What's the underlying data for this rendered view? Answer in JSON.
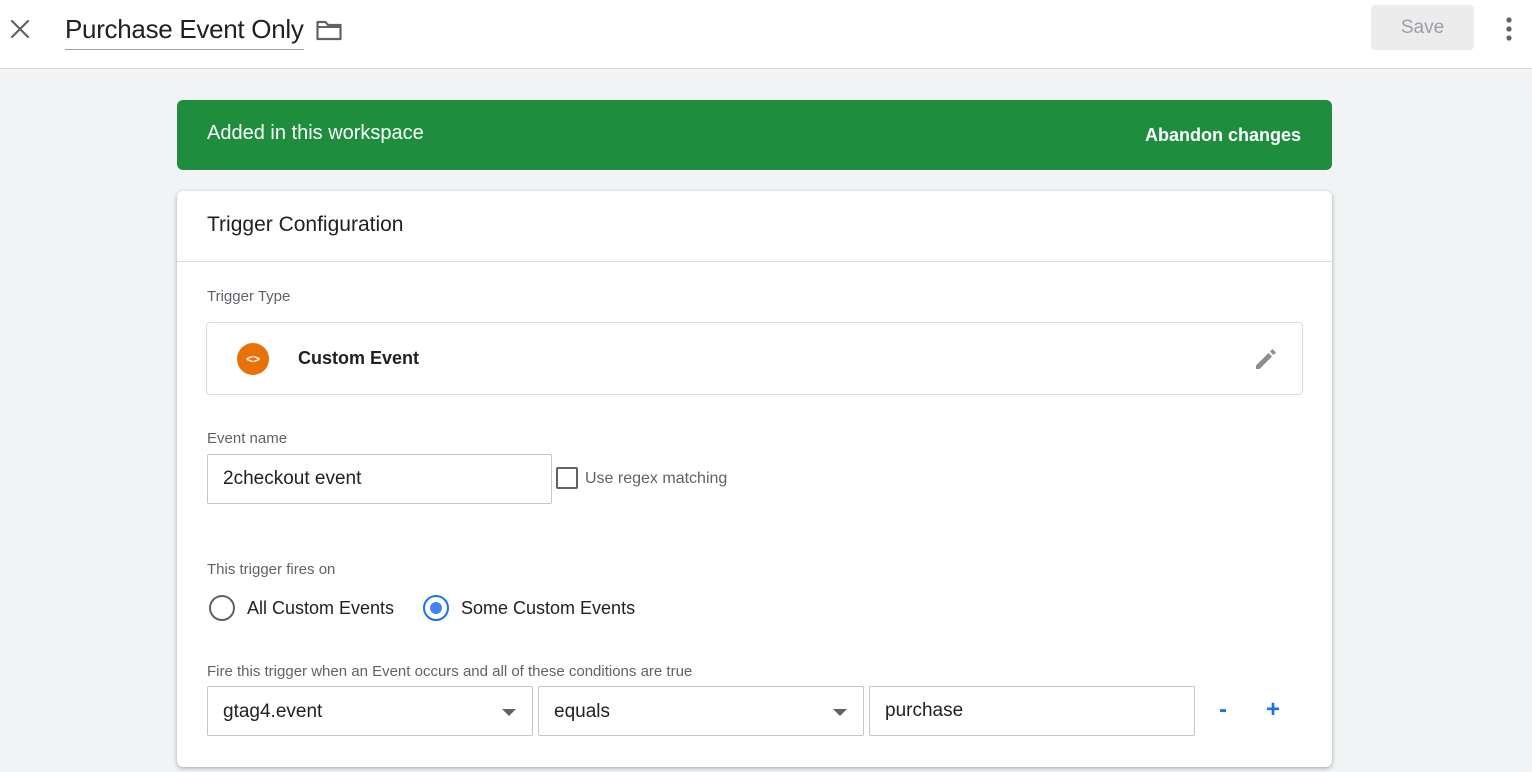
{
  "header": {
    "title": "Purchase Event Only",
    "save_label": "Save"
  },
  "banner": {
    "message": "Added in this workspace",
    "action_label": "Abandon changes",
    "color": "#1e8e3e"
  },
  "card": {
    "title": "Trigger Configuration",
    "trigger_type": {
      "label": "Trigger Type",
      "name": "Custom Event",
      "icon_glyph": "<>",
      "icon_color": "#e8710a"
    },
    "event_name": {
      "label": "Event name",
      "value": "2checkout event",
      "regex_label": "Use regex matching",
      "regex_checked": false
    },
    "fires_on": {
      "label": "This trigger fires on",
      "options": [
        "All Custom Events",
        "Some Custom Events"
      ],
      "selected": "Some Custom Events"
    },
    "conditions": {
      "label": "Fire this trigger when an Event occurs and all of these conditions are true",
      "rows": [
        {
          "variable": "gtag4.event",
          "operator": "equals",
          "value": "purchase"
        }
      ],
      "remove_label": "-",
      "add_label": "+"
    }
  }
}
